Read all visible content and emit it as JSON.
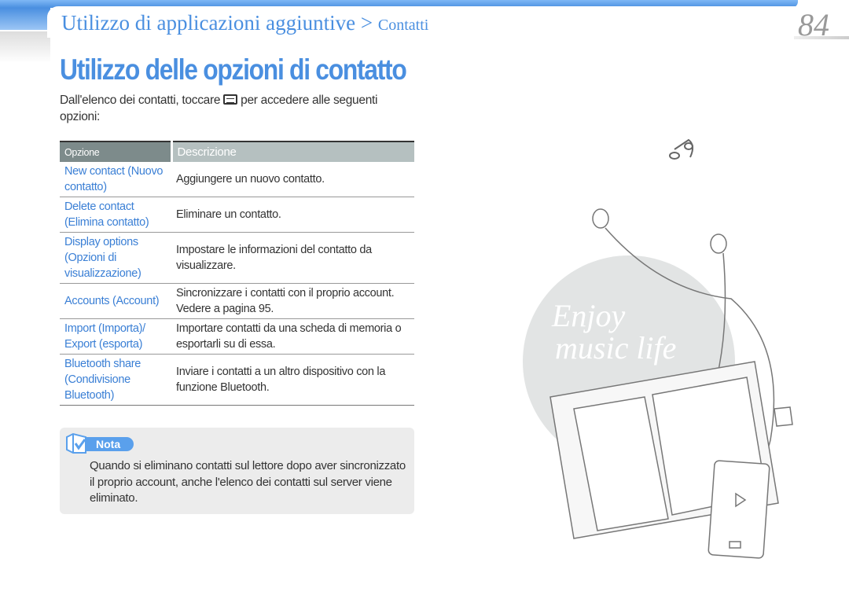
{
  "header": {
    "section": "Utilizzo di applicazioni aggiuntive",
    "separator": ">",
    "subsection": "Contatti",
    "page_number": "84"
  },
  "title": "Utilizzo delle opzioni di contatto",
  "intro": {
    "before": "Dall'elenco dei contatti, toccare",
    "icon": "menu-icon",
    "after": "per accedere alle seguenti opzioni:"
  },
  "table": {
    "headers": [
      "Opzione",
      "Descrizione"
    ],
    "rows": [
      {
        "option": "New contact (Nuovo contatto)",
        "description": "Aggiungere un nuovo contatto."
      },
      {
        "option": "Delete contact (Elimina contatto)",
        "description": "Eliminare un contatto."
      },
      {
        "option": "Display options (Opzioni di visualizzazione)",
        "description": "Impostare le informazioni del contatto da visualizzare."
      },
      {
        "option": "Accounts (Account)",
        "description": "Sincronizzare i contatti con il proprio account. Vedere a pagina 95."
      },
      {
        "option": "Import (Importa)/ Export (esporta)",
        "description": "Importare contatti da una scheda di memoria o esportarli su di essa."
      },
      {
        "option": "Bluetooth share (Condivisione Bluetooth)",
        "description": "Inviare i contatti a un altro dispositivo con la funzione Bluetooth."
      }
    ]
  },
  "note": {
    "label": "Nota",
    "text": "Quando si eliminano contatti sul lettore dopo aver sincronizzato il proprio account, anche l'elenco dei contatti sul server viene eliminato."
  },
  "illustration": {
    "line1": "Enjoy",
    "line2": "music life"
  },
  "colors": {
    "accent": "#4a8fe0",
    "link": "#3a7fd5"
  }
}
